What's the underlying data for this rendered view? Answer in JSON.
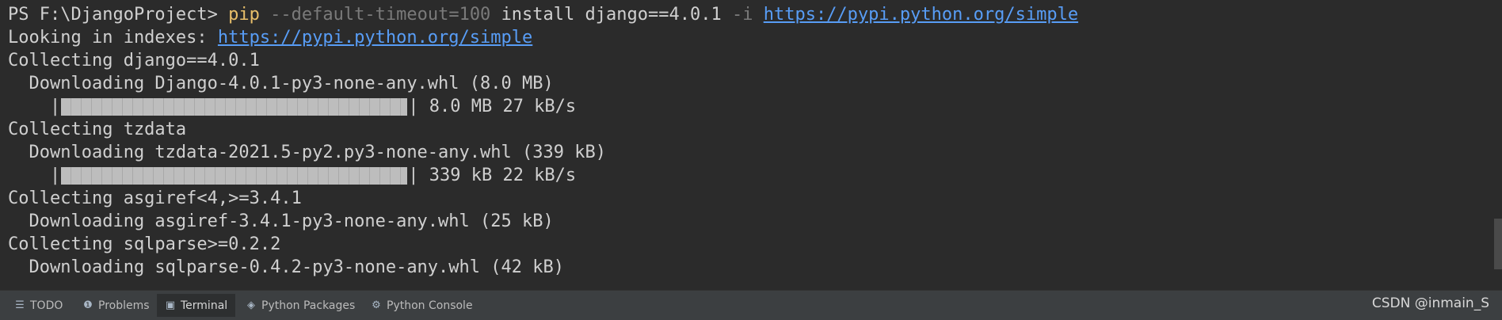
{
  "terminal": {
    "prompt": "PS F:\\DjangoProject> ",
    "cmd_pip": "pip",
    "cmd_opt1": "--default-timeout=100",
    "cmd_install": "install django==4.0.1",
    "cmd_opt2": "-i",
    "cmd_url": "https://pypi.python.org/simple",
    "looking_prefix": "Looking in indexes: ",
    "looking_url": "https://pypi.python.org/simple",
    "collect_django": "Collecting django==4.0.1",
    "download_django": "  Downloading Django-4.0.1-py3-none-any.whl (8.0 MB)",
    "progress1": {
      "fraction": 1.0,
      "stats": " 8.0 MB 27 kB/s"
    },
    "collect_tzdata": "Collecting tzdata",
    "download_tzdata": "  Downloading tzdata-2021.5-py2.py3-none-any.whl (339 kB)",
    "progress2": {
      "fraction": 1.0,
      "stats": " 339 kB 22 kB/s"
    },
    "collect_asgiref": "Collecting asgiref<4,>=3.4.1",
    "download_asgiref": "  Downloading asgiref-3.4.1-py3-none-any.whl (25 kB)",
    "collect_sqlparse": "Collecting sqlparse>=0.2.2",
    "download_sqlparse": "  Downloading sqlparse-0.4.2-py3-none-any.whl (42 kB)"
  },
  "bottom_tabs": [
    {
      "label": "TODO",
      "icon": "list-icon"
    },
    {
      "label": "Problems",
      "icon": "problems-icon"
    },
    {
      "label": "Terminal",
      "icon": "terminal-icon"
    },
    {
      "label": "Python Packages",
      "icon": "packages-icon"
    },
    {
      "label": "Python Console",
      "icon": "python-console-icon"
    }
  ],
  "watermark": "CSDN @inmain_S",
  "colors": {
    "background": "#2b2b2b",
    "pip": "#e8bf6a",
    "option": "#7a7a7a",
    "link": "#589df6",
    "text": "#d0d0d0"
  }
}
